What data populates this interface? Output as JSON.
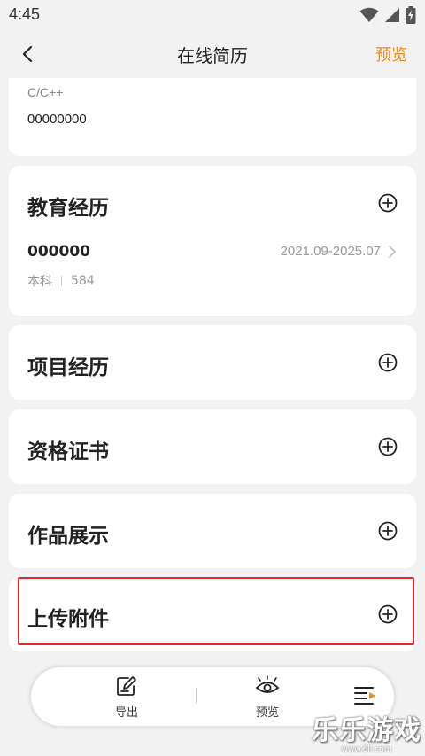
{
  "status": {
    "time": "4:45"
  },
  "nav": {
    "title": "在线简历",
    "preview": "预览"
  },
  "skills": {
    "label": "C/C++",
    "value": "00000000"
  },
  "education": {
    "title": "教育经历",
    "school": "000000",
    "date_range": "2021.09-2025.07",
    "degree": "本科",
    "score": "584"
  },
  "sections": {
    "projects": "项目经历",
    "certificates": "资格证书",
    "works": "作品展示",
    "attachments": "上传附件"
  },
  "bottom_bar": {
    "export": "导出",
    "preview": "预览"
  },
  "watermark": {
    "main": "乐乐游戏",
    "sub": "www.6ll.com"
  },
  "colors": {
    "accent": "#f08a1a",
    "highlight": "#e02828",
    "background": "#f2f2f2"
  }
}
